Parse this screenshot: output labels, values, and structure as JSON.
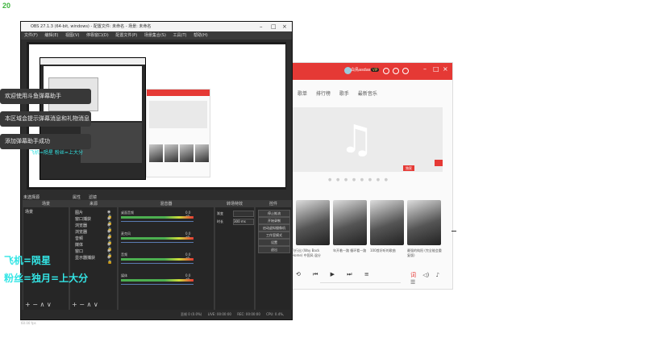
{
  "corner_number": "20",
  "music": {
    "user": "白鳥asdas",
    "vip": "VIP",
    "nav": [
      "歌单",
      "排行榜",
      "歌手",
      "最新音乐"
    ],
    "banner_tag": "独家",
    "captions": [
      "飞行出 (Way Back Home) 中国风·温分",
      "年开着一路 循环看一路",
      "100首好听的歌曲",
      "最强的纯阳 (完全能会重复版)"
    ],
    "colors": {
      "accent": "#e53935"
    }
  },
  "obs": {
    "title": "OBS 27.1.3 (64-bit, windows) - 配置文件: 未命名 - 场景: 未命名",
    "menu": [
      "文件(F)",
      "编辑(E)",
      "视图(V)",
      "停靠窗口(D)",
      "配置文件(P)",
      "场景集合(S)",
      "工具(T)",
      "帮助(H)"
    ],
    "toasts": [
      "欢迎使用斗鱼弹幕助手",
      "本区域会提示弹幕消息和礼物消息",
      "添加弹幕助手成功"
    ],
    "toast_cyan": "飞机=陨星 粉丝=上大分",
    "no_source_selected": "未选择源",
    "properties_label": "属性",
    "filters_label": "滤镜",
    "panels": {
      "scenes": "场景",
      "sources": "来源",
      "mixer": "混音器",
      "transitions": "转场特效",
      "controls": "控件"
    },
    "scene_item": "场景",
    "sources": [
      "图片",
      "窗口捕获",
      "浏览器",
      "浏览器",
      "音频",
      "媒体",
      "窗口",
      "显示器捕获"
    ],
    "mixer": [
      {
        "name": "桌面音频",
        "db": "0.0 dB"
      },
      {
        "name": "麦克风",
        "db": "0.0 dB"
      },
      {
        "name": "音频",
        "db": "0.0 dB"
      },
      {
        "name": "媒体",
        "db": "0.0 dB"
      }
    ],
    "transition_rows": [
      {
        "label": "渐变",
        "value": ""
      },
      {
        "label": "时长",
        "value": "300 ms"
      }
    ],
    "controls": [
      "停止推流",
      "开始录制",
      "启动虚拟摄像机",
      "工作室模式",
      "设置",
      "退出"
    ],
    "status": [
      "丢帧 0 (0.0%)",
      "LIVE: 00:00:00",
      "REC: 00:00:00",
      "CPU: 0.4%, 60.00 fps"
    ],
    "footer_icons": "+ − ∧ ∨"
  },
  "overlay": {
    "line1": "飞机=陨星",
    "line2": "粉丝=独月=上大分"
  }
}
